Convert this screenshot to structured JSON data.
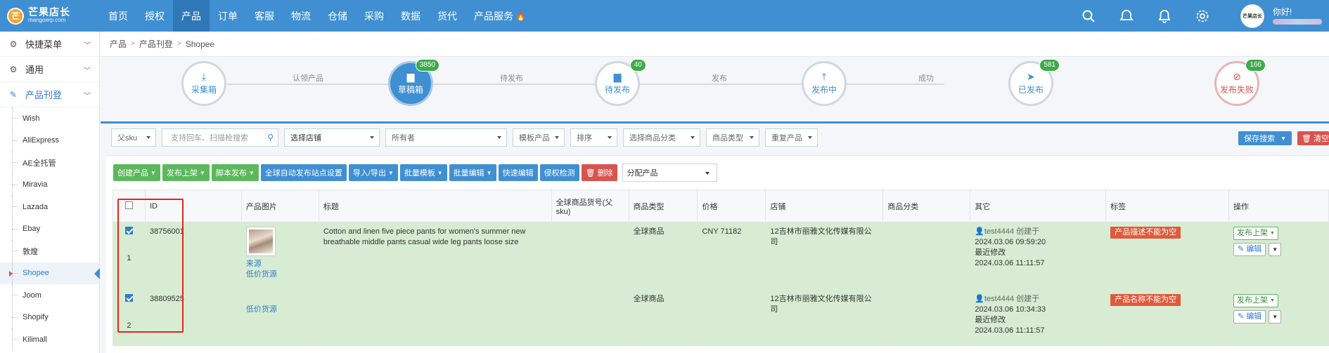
{
  "brand": {
    "name": "芒果店长",
    "domain": "mangoerp.com"
  },
  "topnav": {
    "items": [
      "首页",
      "授权",
      "产品",
      "订单",
      "客服",
      "物流",
      "仓储",
      "采购",
      "数据",
      "货代",
      "产品服务"
    ],
    "active_index": 2,
    "greeting": "你好!"
  },
  "sidebar": {
    "sections": [
      {
        "label": "快捷菜单",
        "icon": "gear-icon"
      },
      {
        "label": "通用",
        "icon": "gear-icon"
      },
      {
        "label": "产品刊登",
        "icon": "edit-icon"
      }
    ],
    "items": [
      "Wish",
      "AliExpress",
      "AE全托管",
      "Miravia",
      "Lazada",
      "Ebay",
      "敦煌",
      "Shopee",
      "Joom",
      "Shopify",
      "Kilimall"
    ],
    "active_item": "Shopee"
  },
  "breadcrumb": [
    "产品",
    "产品刊登",
    "Shopee"
  ],
  "workflow": {
    "steps": [
      {
        "label": "采集箱",
        "icon": "download-icon",
        "count": ""
      },
      {
        "label": "草稿箱",
        "icon": "folder-icon",
        "count": "3850"
      },
      {
        "label": "待发布",
        "icon": "folder-icon",
        "count": "40"
      },
      {
        "label": "发布中",
        "icon": "upload-icon",
        "count": ""
      },
      {
        "label": "已发布",
        "icon": "send-icon",
        "count": "581"
      },
      {
        "label": "发布失败",
        "icon": "eye-slash-icon",
        "count": "166"
      }
    ],
    "transitions": [
      "认领产品",
      "待发布",
      "发布",
      "成功"
    ]
  },
  "filters": {
    "sku_type": "父sku",
    "search_placeholder": "支持回车、扫描枪搜索",
    "store": "选择店铺",
    "owner": "所有者",
    "template": "模板产品",
    "sort": "排序",
    "category": "选择商品分类",
    "product_type": "商品类型",
    "duplicate": "重复产品",
    "save_search": "保存搜索",
    "clear": "清空"
  },
  "toolbar": {
    "create": "创建产品",
    "publish": "发布上架",
    "script_publish": "脚本发布",
    "global_auto": "全球自动发布站点设置",
    "import_export": "导入/导出",
    "batch_template": "批量模板",
    "batch_edit": "批量编辑",
    "quick_edit": "快速编辑",
    "infringe_check": "侵权检测",
    "delete": "删除",
    "assign": "分配产品"
  },
  "table": {
    "headers": [
      "ID",
      "产品图片",
      "标题",
      "全球商品货号(父sku)",
      "商品类型",
      "价格",
      "店铺",
      "商品分类",
      "其它",
      "标签",
      "操作"
    ],
    "rows": [
      {
        "num": "1",
        "id": "38756001",
        "img_link1": "来源",
        "img_link2": "低价货源",
        "title": "Cotton and linen five piece pants for women's summer new breathable middle pants casual wide leg pants loose size",
        "sku": "",
        "type": "全球商品",
        "price": "CNY 71182",
        "store": "12吉林市丽雅文化传媒有限公司",
        "category": "",
        "user": "test4444",
        "created_label": "创建于",
        "created": "2024.03.06 09:59:20",
        "modified_label": "最近修改",
        "modified": "2024.03.06 11:11:57",
        "tag": "产品描述不能为空",
        "op_publish": "发布上架",
        "op_edit": "编辑"
      },
      {
        "num": "2",
        "id": "38809525",
        "img_link1": "低价货源",
        "title": "",
        "sku": "",
        "type": "全球商品",
        "price": "",
        "store": "12吉林市丽雅文化传媒有限公司",
        "category": "",
        "user": "test4444",
        "created_label": "创建于",
        "created": "2024.03.06 10:34:33",
        "modified_label": "最近修改",
        "modified": "2024.03.06 11:11:57",
        "tag": "产品名称不能为空",
        "op_publish": "发布上架",
        "op_edit": "编辑"
      }
    ]
  }
}
